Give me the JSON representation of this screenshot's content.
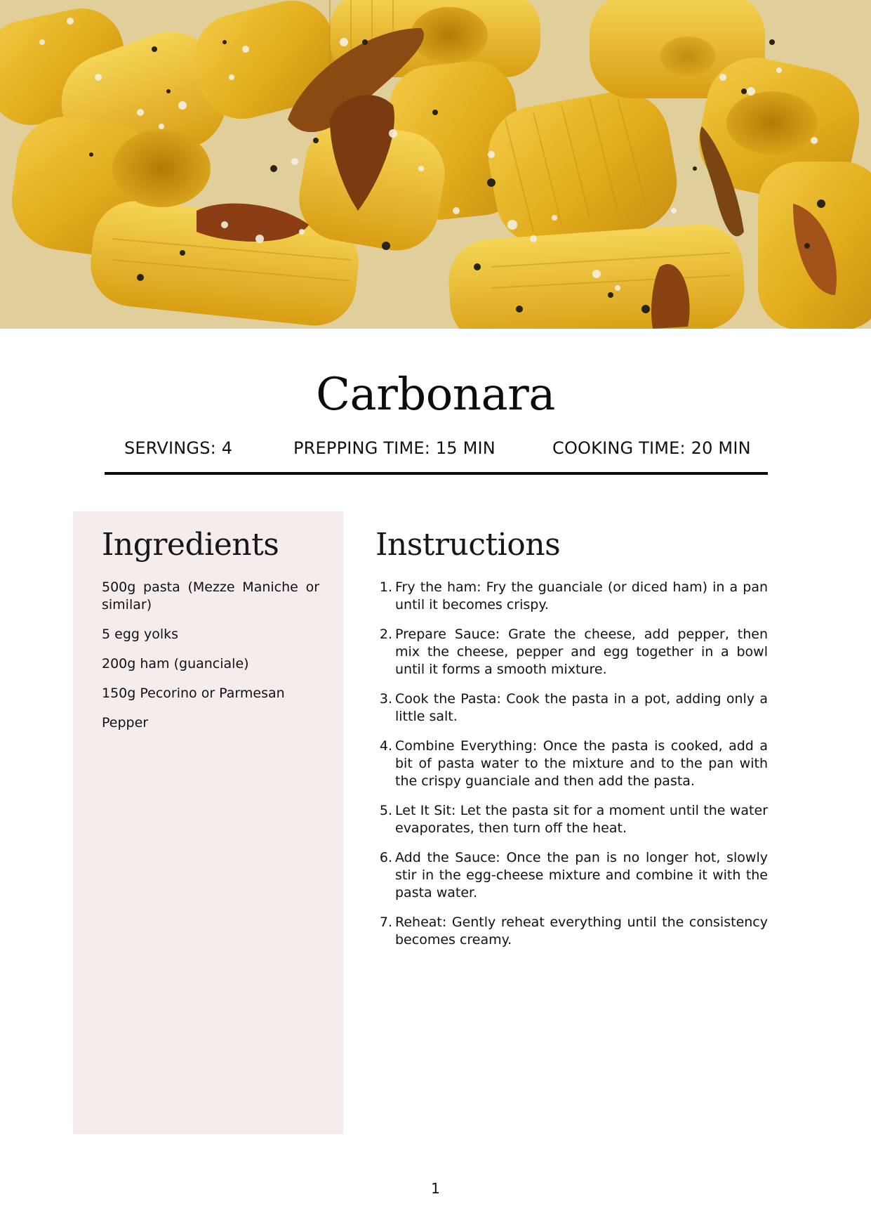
{
  "hero": {
    "image_icon": "carbonara-pasta-photo"
  },
  "recipe": {
    "title": "Carbonara",
    "servings": "SERVINGS: 4",
    "prepping_time": "PREPPING TIME: 15 MIN",
    "cooking_time": "COOKING TIME: 20 MIN"
  },
  "ingredients": {
    "heading": "Ingredients",
    "items": [
      "500g pasta (Mezze Maniche or similar)",
      "5 egg yolks",
      "200g ham (guanciale)",
      "150g Pecorino or Parmesan",
      "Pepper"
    ]
  },
  "instructions": {
    "heading": "Instructions",
    "steps": [
      {
        "num": "1.",
        "text": "Fry the ham: Fry the guanciale (or diced ham) in a pan until it becomes crispy."
      },
      {
        "num": "2.",
        "text": "Prepare Sauce: Grate the cheese, add pepper, then mix the cheese, pepper and egg together in a bowl until it forms a smooth mixture."
      },
      {
        "num": "3.",
        "text": "Cook the Pasta: Cook the pasta in a pot, adding only a little salt."
      },
      {
        "num": "4.",
        "text": "Combine Everything: Once the pasta is cooked, add a bit of pasta water to the mixture and to the pan with the crispy guanciale and then add the pasta."
      },
      {
        "num": "5.",
        "text": "Let It Sit: Let the pasta sit for a moment until the water evaporates, then turn off the heat."
      },
      {
        "num": "6.",
        "text": "Add the Sauce: Once the pan is no longer hot, slowly stir in the egg-cheese mixture and combine it with the pasta water."
      },
      {
        "num": "7.",
        "text": "Reheat: Gently reheat everything until the consistency becomes creamy."
      }
    ]
  },
  "footer": {
    "page_number": "1"
  },
  "colors": {
    "ingredients_panel": "#f6eceb",
    "rule": "#0d0d0d",
    "pasta": "#e6b624"
  }
}
